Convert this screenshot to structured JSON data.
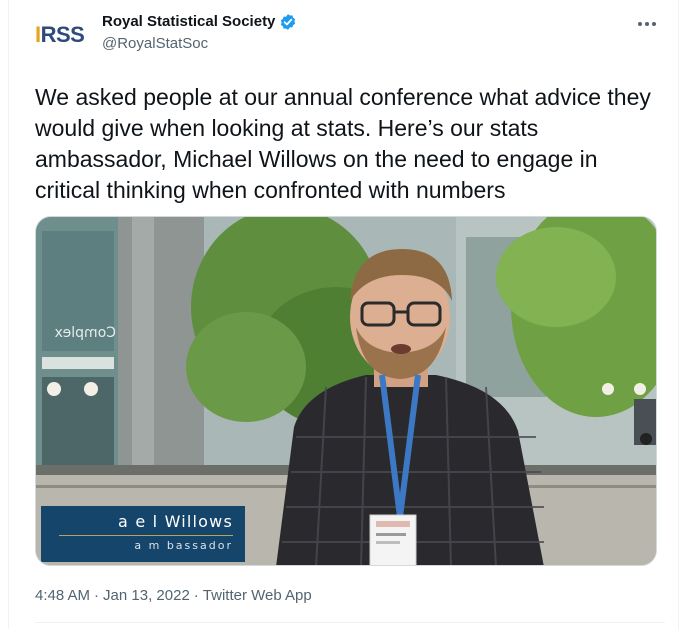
{
  "author": {
    "avatar_letters": [
      "I",
      "RSS"
    ],
    "display_name": "Royal Statistical Society",
    "handle": "@RoyalStatSoc",
    "verified_icon": "verified-badge-icon"
  },
  "more_menu_icon": "more-horizontal-icon",
  "tweet": {
    "text": "We asked people at our annual conference what advice they would give when looking at stats. Here’s our stats ambassador, Michael Willows on the need to engage in critical thinking when confronted with numbers"
  },
  "video": {
    "background_text": "Complex",
    "lower_third_name": "a e l  Willows",
    "lower_third_role": "a m bassador"
  },
  "meta": {
    "time": "4:48 AM",
    "date": "Jan 13, 2022",
    "source": "Twitter Web App"
  },
  "colors": {
    "text": "#0f1419",
    "secondary": "#536471",
    "verified": "#1d9bf0",
    "lower_third": "#15456a",
    "brand_accent": "#e8a320",
    "brand_primary": "#2c4a7c"
  }
}
